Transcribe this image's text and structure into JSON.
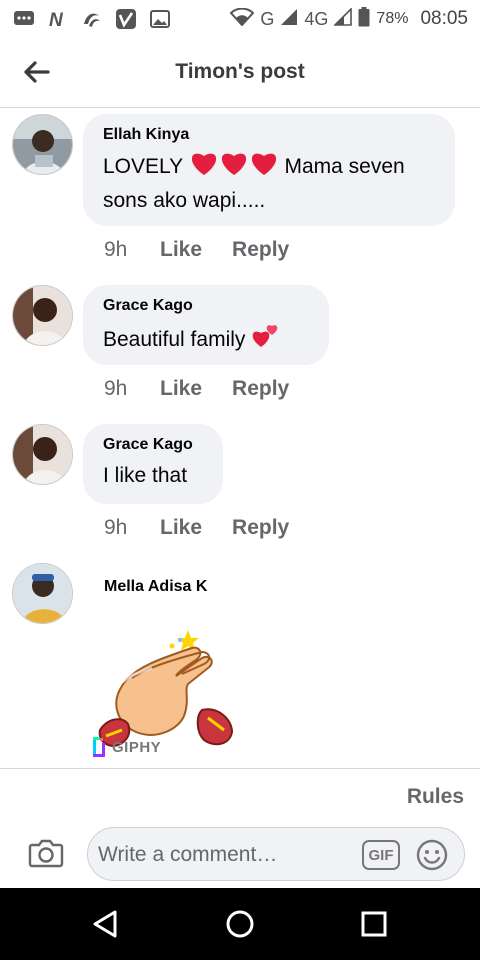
{
  "status_bar": {
    "network_labels": [
      "G",
      "4G"
    ],
    "battery": "78%",
    "time": "08:05",
    "icons": [
      "messages-icon",
      "netflix-icon",
      "nairaland-icon",
      "vimeo-icon",
      "gallery-icon",
      "wifi-icon",
      "signal-icon",
      "battery-icon"
    ]
  },
  "header": {
    "title": "Timon's post",
    "back_icon": "back-arrow-icon"
  },
  "comments": [
    {
      "author": "Ellah Kinya",
      "text_before": "LOVELY ",
      "hearts": 3,
      "text_after": " Mama seven sons ako wapi.....",
      "time": "9h",
      "like": "Like",
      "reply": "Reply"
    },
    {
      "author": "Grace Kago",
      "text_before": "Beautiful family ",
      "sticker_emoji": "two-hearts",
      "time": "9h",
      "like": "Like",
      "reply": "Reply"
    },
    {
      "author": "Grace Kago",
      "text_before": "I like that",
      "time": "9h",
      "like": "Like",
      "reply": "Reply"
    },
    {
      "author": "Mella Adisa K",
      "attachment": "clapping-hands-gif",
      "attachment_source": "GIPHY"
    }
  ],
  "footer": {
    "rules": "Rules",
    "placeholder": "Write a comment…",
    "gif_label": "GIF"
  },
  "colors": {
    "bubble": "#f0f2f5",
    "secondary_text": "#65676b",
    "heart": "#e41e3f"
  }
}
